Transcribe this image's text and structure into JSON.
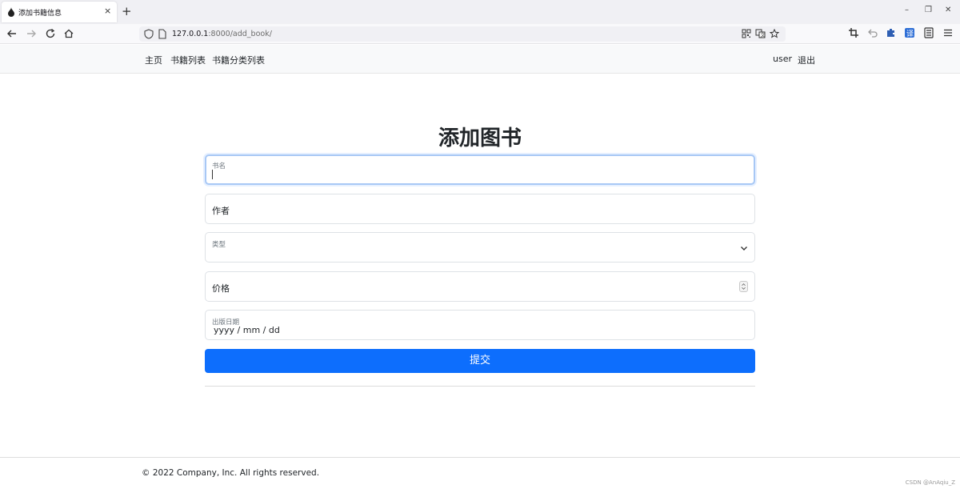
{
  "browser": {
    "tab_title": "添加书籍信息",
    "tab_close_glyph": "×",
    "new_tab_glyph": "+",
    "window_controls": {
      "minimize": "–",
      "restore": "❐",
      "close": "✕"
    },
    "url_host": "127.0.0.1",
    "url_rest": ":8000/add_book/",
    "nav_icons": [
      "back-icon",
      "forward-icon",
      "reload-icon",
      "home-icon"
    ],
    "toolbar_icons": [
      "qr-icon",
      "translate-icon",
      "bookmark-star-icon",
      "crop-icon",
      "undo-icon",
      "extension-icon",
      "translate-ext-icon",
      "reader-icon",
      "menu-icon"
    ]
  },
  "navbar": {
    "links": [
      "主页",
      "书籍列表",
      "书籍分类列表"
    ],
    "user": "user",
    "logout": "退出"
  },
  "form": {
    "title": "添加图书",
    "name_label": "书名",
    "author_label": "作者",
    "category_label": "类型",
    "price_label": "价格",
    "pub_date_label": "出版日期",
    "pub_date_placeholder": "yyyy / mm / dd",
    "submit_label": "提交"
  },
  "footer": {
    "copyright": "© 2022 Company, Inc. All rights reserved."
  },
  "watermark": "CSDN @AnAqiu_Z",
  "colors": {
    "primary": "#0d6efd",
    "navbar_bg": "#f8f9fa",
    "focus_border": "#a8c8f5"
  }
}
